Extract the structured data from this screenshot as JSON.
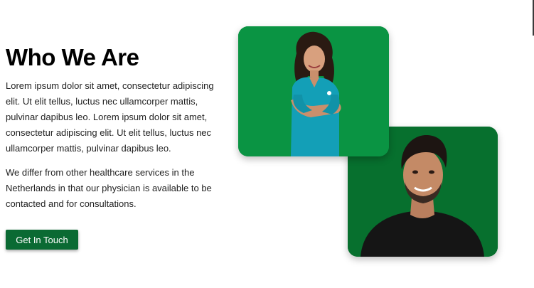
{
  "section": {
    "title": "Who We Are",
    "paragraph1": "Lorem ipsum dolor sit amet, consectetur adipiscing elit. Ut elit tellus, luctus nec ullamcorper mattis, pulvinar dapibus leo. Lorem ipsum dolor sit amet, consectetur adipiscing elit. Ut elit tellus, luctus nec ullamcorper mattis, pulvinar dapibus leo.",
    "paragraph2": "We differ from other healthcare services in the Netherlands in that our physician is available to be contacted and for consultations.",
    "cta_label": "Get In Touch"
  },
  "colors": {
    "brand_green": "#0a6a33",
    "photo_bg_light": "#0a9443",
    "photo_bg_dark": "#07702e",
    "scrub_teal": "#139fb7"
  }
}
